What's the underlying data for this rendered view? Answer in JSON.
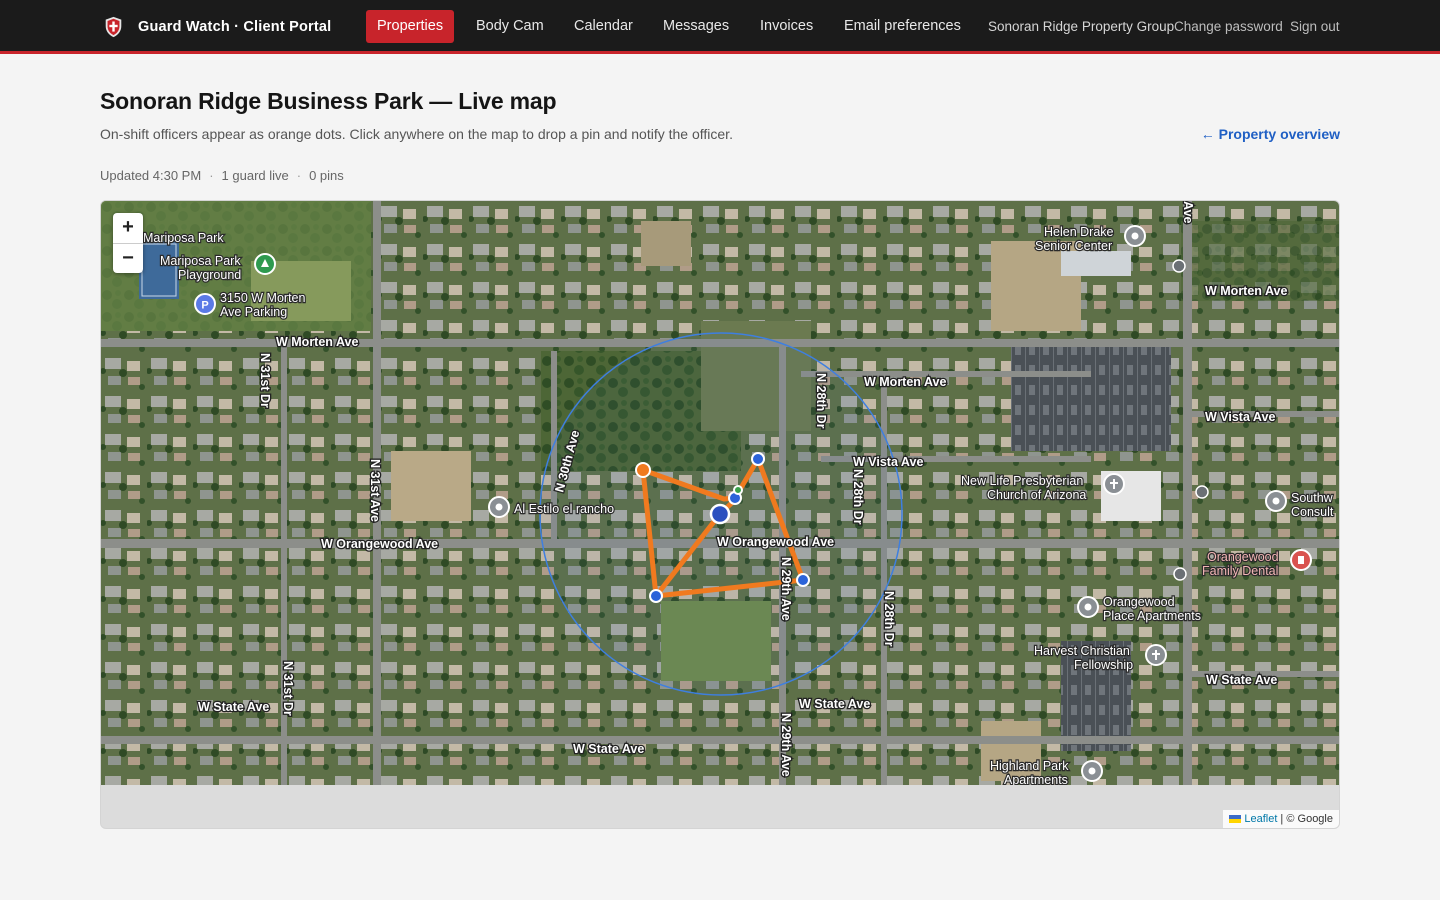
{
  "app": {
    "brand": "Guard Watch · Client Portal"
  },
  "nav": {
    "items": [
      "Properties",
      "Body Cam",
      "Calendar",
      "Messages",
      "Invoices",
      "Email preferences"
    ],
    "active": "Properties",
    "org_name": "Sonoran Ridge Property Group",
    "change_password": "Change password",
    "sign_out": "Sign out"
  },
  "page": {
    "title": "Sonoran Ridge Business Park — Live map",
    "subtitle": "On-shift officers appear as orange dots. Click anywhere on the map to drop a pin and notify the officer.",
    "back_link": "← Property overview",
    "updated": "Updated 4:30 PM",
    "guards_live": "1 guard live",
    "pins": "0 pins"
  },
  "map": {
    "zoom_in": "+",
    "zoom_out": "−",
    "attribution_leaflet": "Leaflet",
    "attribution_sep": " | ",
    "attribution_provider": "© Google",
    "colors": {
      "route": "#f07a1f",
      "geofence": "#3e7fe0",
      "waypoint": "#2b63d9",
      "nav_accent": "#c8242b"
    },
    "streets": {
      "morten_w": "W Morten Ave",
      "morten_mid": "W Morten Ave",
      "morten_e": "W Morten Ave",
      "vista_mid": "W Vista Ave",
      "vista_e": "W Vista Ave",
      "orangewood_w": "W Orangewood Ave",
      "orangewood_mid": "W Orangewood Ave",
      "state_w": "W State Ave",
      "state_mid": "W State Ave",
      "state_mid2": "W State Ave",
      "state_e": "W State Ave",
      "n31st_dr_n": "N 31st Dr",
      "n31st_ave": "N 31st Ave",
      "n31st_dr_s": "N 31st Dr",
      "n30th_ave": "N 30th Ave",
      "n28th_dr_n": "N 28th Dr",
      "n28th_dr_mid": "N 28th Dr",
      "n28th_dr_s": "N 28th Dr",
      "n29th_ave_n": "N 29th Ave",
      "n29th_ave_s": "N 29th Ave",
      "ave_top": "Ave"
    },
    "places": {
      "mariposa_park": "Mariposa Park",
      "mariposa_playground_1": "Mariposa Park",
      "mariposa_playground_2": "Playground",
      "parking_1": "3150 W Morten",
      "parking_2": "Ave Parking",
      "helen_drake_1": "Helen Drake",
      "helen_drake_2": "Senior Center",
      "al_estilo": "Al Estilo el rancho",
      "new_life_1": "New Life Presbyterian",
      "new_life_2": "Church of Arizona",
      "southwest_1": "Southw",
      "southwest_2": "Consult",
      "orangewood_dental_1": "Orangewood",
      "orangewood_dental_2": "Family Dental",
      "orangewood_place_1": "Orangewood",
      "orangewood_place_2": "Place Apartments",
      "harvest_1": "Harvest Christian",
      "harvest_2": "Fellowship",
      "highland_1": "Highland Park",
      "highland_2": "Apartments"
    }
  }
}
